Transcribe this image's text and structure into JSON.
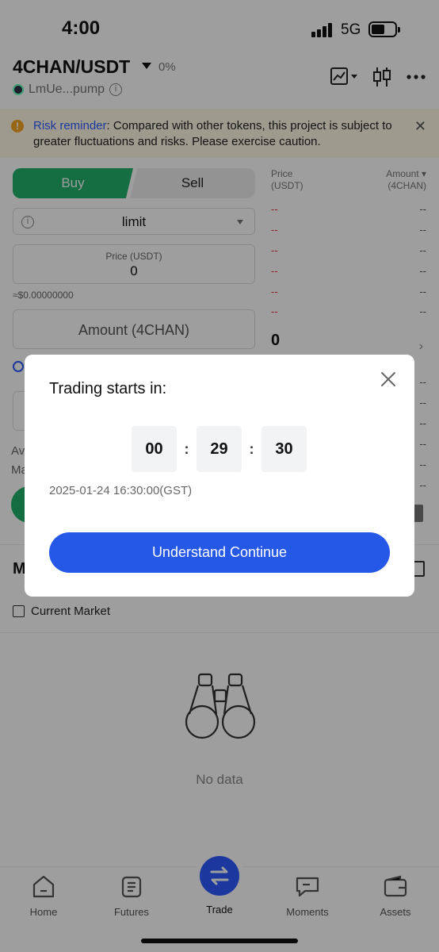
{
  "status_bar": {
    "time": "4:00",
    "network": "5G"
  },
  "header": {
    "pair": "4CHAN/USDT",
    "change": "0%",
    "token_address": "LmUe...pump"
  },
  "risk_banner": {
    "label": "Risk reminder",
    "message": ": Compared with other tokens, this project is subject to greater fluctuations and risks. Please exercise caution."
  },
  "order_form": {
    "buy_label": "Buy",
    "sell_label": "Sell",
    "order_type": "limit",
    "price_label": "Price (USDT)",
    "price_value": "0",
    "approx_value": "≈$0.00000000",
    "amount_placeholder": "Amount (4CHAN)",
    "partial_labels": [
      "Av",
      "Ma"
    ]
  },
  "order_book": {
    "price_header": "Price\n(USDT)",
    "amount_header": "Amount ▾\n(4CHAN)",
    "placeholder_price": "--",
    "placeholder_amount": "--",
    "last_price": "0"
  },
  "orders_section": {
    "title_partial": "M",
    "current_market_label": "Current Market",
    "empty_text": "No data"
  },
  "tab_bar": {
    "items": [
      {
        "label": "Home",
        "icon": "home-icon"
      },
      {
        "label": "Futures",
        "icon": "futures-icon"
      },
      {
        "label": "Trade",
        "icon": "trade-icon"
      },
      {
        "label": "Moments",
        "icon": "moments-icon"
      },
      {
        "label": "Assets",
        "icon": "wallet-icon"
      }
    ],
    "active": "Trade"
  },
  "modal": {
    "title": "Trading starts in:",
    "countdown": {
      "hours": "00",
      "minutes": "29",
      "seconds": "30",
      "separator": ":"
    },
    "start_datetime": "2025-01-24 16:30:00(GST)",
    "confirm_label": "Understand Continue"
  },
  "colors": {
    "buy_green": "#22b06b",
    "sell_red": "#e03a3a",
    "primary_blue": "#2658e8",
    "risk_bg": "#fff8e6"
  }
}
